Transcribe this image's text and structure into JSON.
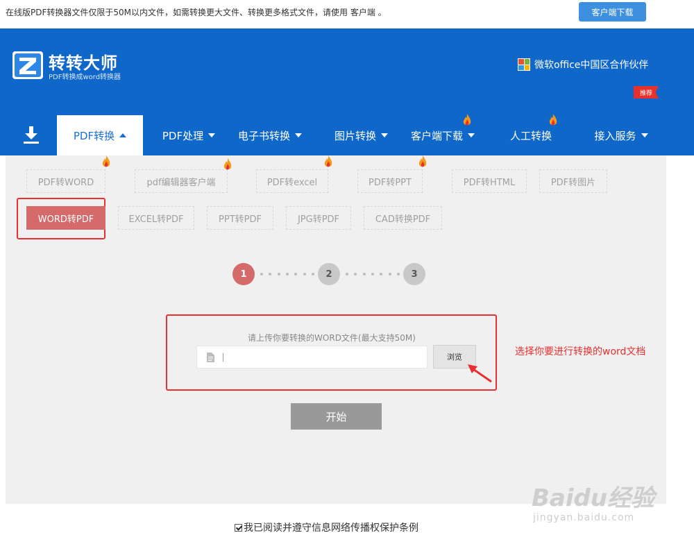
{
  "topbar": {
    "notice": "在线版PDF转换器文件仅限于50M以内文件，如需转换更大文件、转换更多格式文件，请使用 客户端 。",
    "download_button": "客户端下载"
  },
  "header": {
    "logo_title": "转转大师",
    "logo_subtitle": "PDF转换成word转换器",
    "partner": "微软office中国区合作伙伴"
  },
  "nav": {
    "items": [
      {
        "label": "PDF转换"
      },
      {
        "label": "PDF处理"
      },
      {
        "label": "电子书转换"
      },
      {
        "label": "图片转换"
      },
      {
        "label": "客户端下载"
      },
      {
        "label": "人工转换"
      },
      {
        "label": "接入服务"
      }
    ],
    "badge": "推荐"
  },
  "tabs_row1": [
    "PDF转WORD",
    "pdf编辑器客户端",
    "PDF转excel",
    "PDF转PPT",
    "PDF转HTML",
    "PDF转图片"
  ],
  "tabs_row2": [
    "WORD转PDF",
    "EXCEL转PDF",
    "PPT转PDF",
    "JPG转PDF",
    "CAD转换PDF"
  ],
  "steps": [
    "1",
    "2",
    "3"
  ],
  "upload": {
    "label": "请上传你要转换的WORD文件(最大支持50M)",
    "value": "",
    "browse_button": "浏览"
  },
  "annotation": "选择你要进行转换的word文档",
  "start_button": "开始",
  "agreement": "我已阅读并遵守信息网络传播权保护条例",
  "watermark": {
    "brand": "Baidu经验",
    "url": "jingyan.baidu.com"
  },
  "colors": {
    "header_blue": "#0e67c9",
    "active_tab_red": "#d46a6a",
    "annotation_red": "#e8302e"
  }
}
